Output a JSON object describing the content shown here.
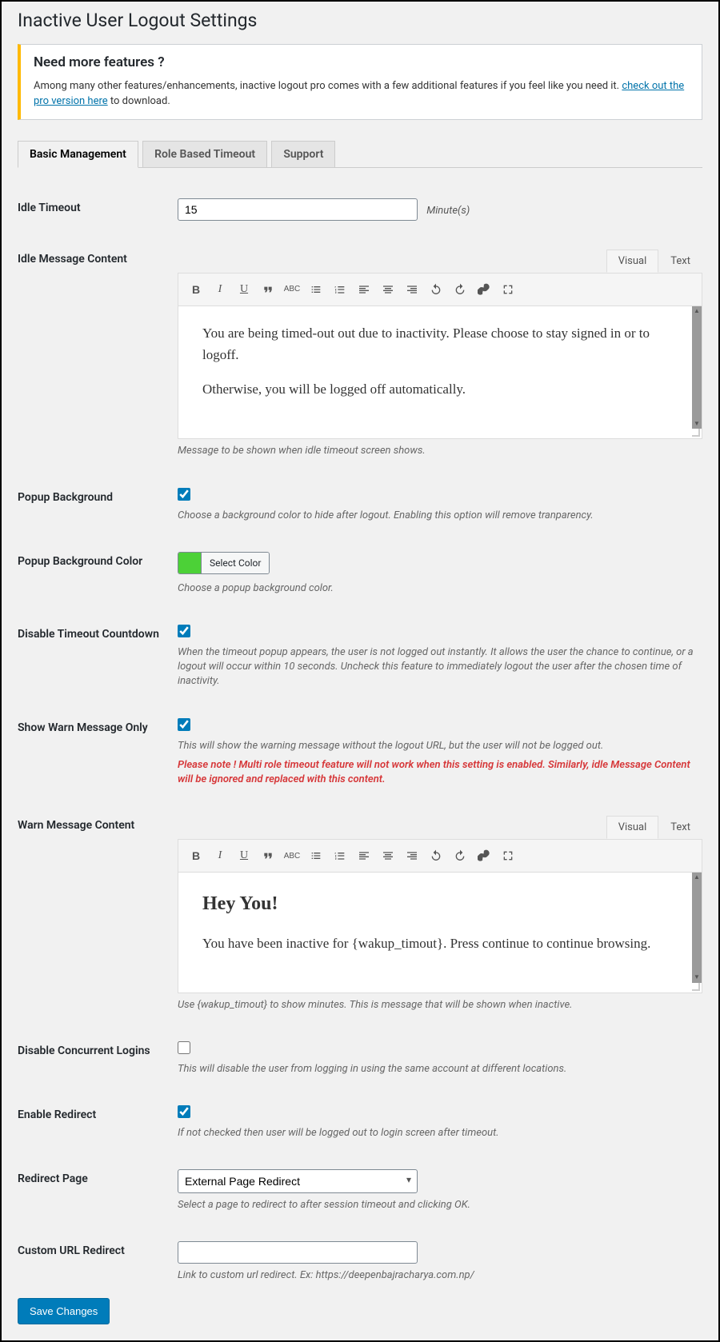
{
  "page_title": "Inactive User Logout Settings",
  "notice": {
    "heading": "Need more features ?",
    "text_before": "Among many other features/enhancements, inactive logout pro comes with a few additional features if you feel like you need it. ",
    "link": "check out the pro version here",
    "text_after": " to download."
  },
  "tabs": [
    "Basic Management",
    "Role Based Timeout",
    "Support"
  ],
  "active_tab": 0,
  "idle_timeout": {
    "label": "Idle Timeout",
    "value": "15",
    "suffix": "Minute(s)"
  },
  "idle_message": {
    "label": "Idle Message Content",
    "tabs": {
      "visual": "Visual",
      "text": "Text"
    },
    "p1": "You are being timed-out out due to inactivity. Please choose to stay signed in or to logoff.",
    "p2": "Otherwise, you will be logged off automatically.",
    "desc": "Message to be shown when idle timeout screen shows."
  },
  "popup_bg": {
    "label": "Popup Background",
    "checked": true,
    "desc": "Choose a background color to hide after logout. Enabling this option will remove tranparency."
  },
  "popup_bg_color": {
    "label": "Popup Background Color",
    "button": "Select Color",
    "color": "#4cd137",
    "desc": "Choose a popup background color."
  },
  "disable_countdown": {
    "label": "Disable Timeout Countdown",
    "checked": true,
    "desc": "When the timeout popup appears, the user is not logged out instantly. It allows the user the chance to continue, or a logout will occur within 10 seconds. Uncheck this feature to immediately logout the user after the chosen time of inactivity."
  },
  "show_warn": {
    "label": "Show Warn Message Only",
    "checked": true,
    "desc": "This will show the warning message without the logout URL, but the user will not be logged out.",
    "warn": "Please note ! Multi role timeout feature will not work when this setting is enabled. Similarly, idle Message Content will be ignored and replaced with this content."
  },
  "warn_message": {
    "label": "Warn Message Content",
    "tabs": {
      "visual": "Visual",
      "text": "Text"
    },
    "h2": "Hey You!",
    "p1": "You have been inactive for {wakup_timout}. Press continue to continue browsing.",
    "desc": "Use {wakup_timout} to show minutes. This is message that will be shown when inactive."
  },
  "disable_concurrent": {
    "label": "Disable Concurrent Logins",
    "checked": false,
    "desc": "This will disable the user from logging in using the same account at different locations."
  },
  "enable_redirect": {
    "label": "Enable Redirect",
    "checked": true,
    "desc": "If not checked then user will be logged out to login screen after timeout."
  },
  "redirect_page": {
    "label": "Redirect Page",
    "value": "External Page Redirect",
    "desc": "Select a page to redirect to after session timeout and clicking OK."
  },
  "custom_url": {
    "label": "Custom URL Redirect",
    "value": "",
    "desc": "Link to custom url redirect. Ex: https://deepenbajracharya.com.np/"
  },
  "save_button": "Save Changes"
}
